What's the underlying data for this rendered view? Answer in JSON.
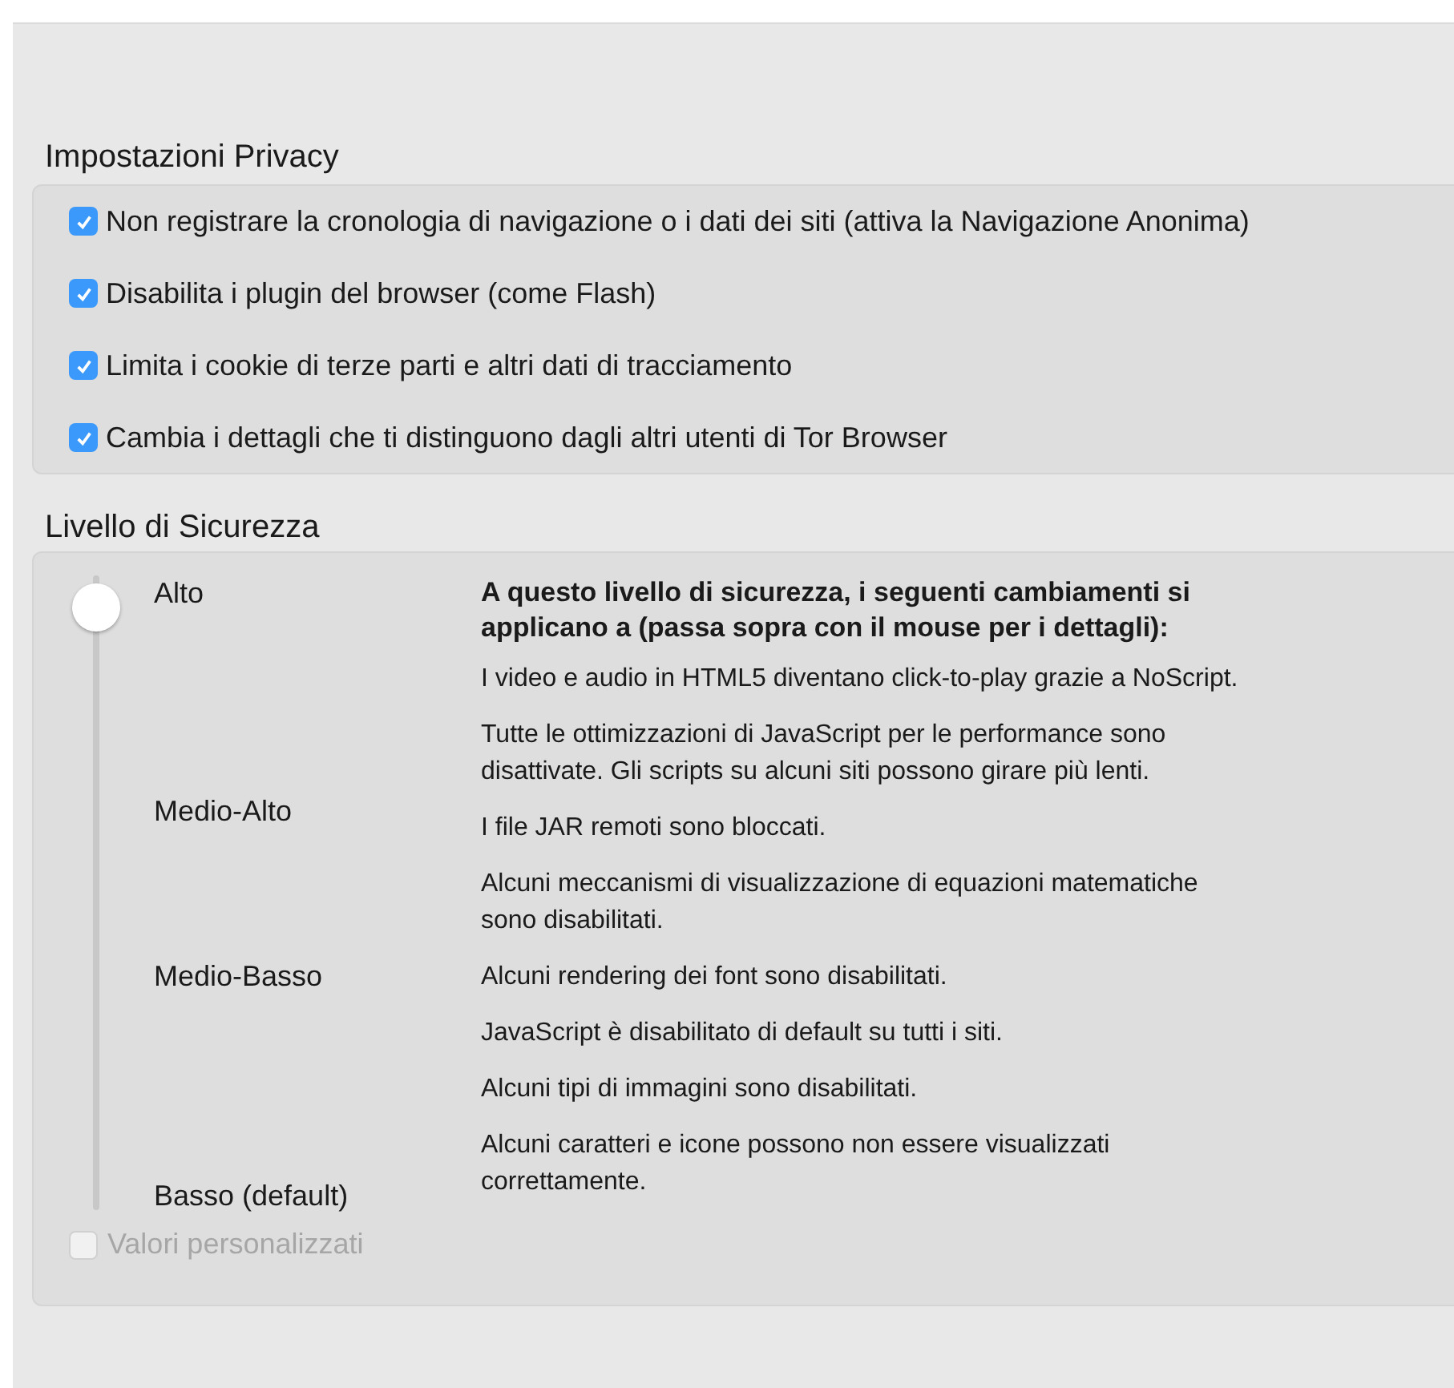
{
  "privacy": {
    "title": "Impostazioni Privacy",
    "options": [
      {
        "label": "Non registrare la cronologia di navigazione o i dati dei siti (attiva la Navigazione Anonima)",
        "checked": true
      },
      {
        "label": "Disabilita i plugin del browser (come Flash)",
        "checked": true
      },
      {
        "label": "Limita i cookie di terze parti e altri dati di tracciamento",
        "checked": true
      },
      {
        "label": "Cambia i dettagli che ti distinguono dagli altri utenti di Tor Browser",
        "checked": true
      }
    ]
  },
  "security": {
    "title": "Livello di Sicurezza",
    "slider": {
      "level": 1,
      "labels": [
        "Alto",
        "Medio-Alto",
        "Medio-Basso",
        "Basso (default)"
      ]
    },
    "description_title": "A questo livello di sicurezza, i seguenti cambiamenti si\napplicano a (passa sopra con il mouse per i dettagli):",
    "changes": [
      "I video e audio in HTML5 diventano click-to-play grazie a NoScript.",
      "Tutte le ottimizzazioni di JavaScript per le performance sono\ndisattivate. Gli scripts su alcuni siti possono girare più lenti.",
      "I file JAR remoti sono bloccati.",
      "Alcuni meccanismi di visualizzazione di equazioni matematiche\nsono disabilitati.",
      "Alcuni rendering dei font sono disabilitati.",
      "JavaScript è disabilitato di default su tutti i siti.",
      "Alcuni tipi di immagini sono disabilitati.",
      "Alcuni caratteri e icone possono non essere visualizzati\ncorrettamente."
    ],
    "custom": {
      "label": "Valori personalizzati",
      "checked": false,
      "disabled": true
    }
  }
}
